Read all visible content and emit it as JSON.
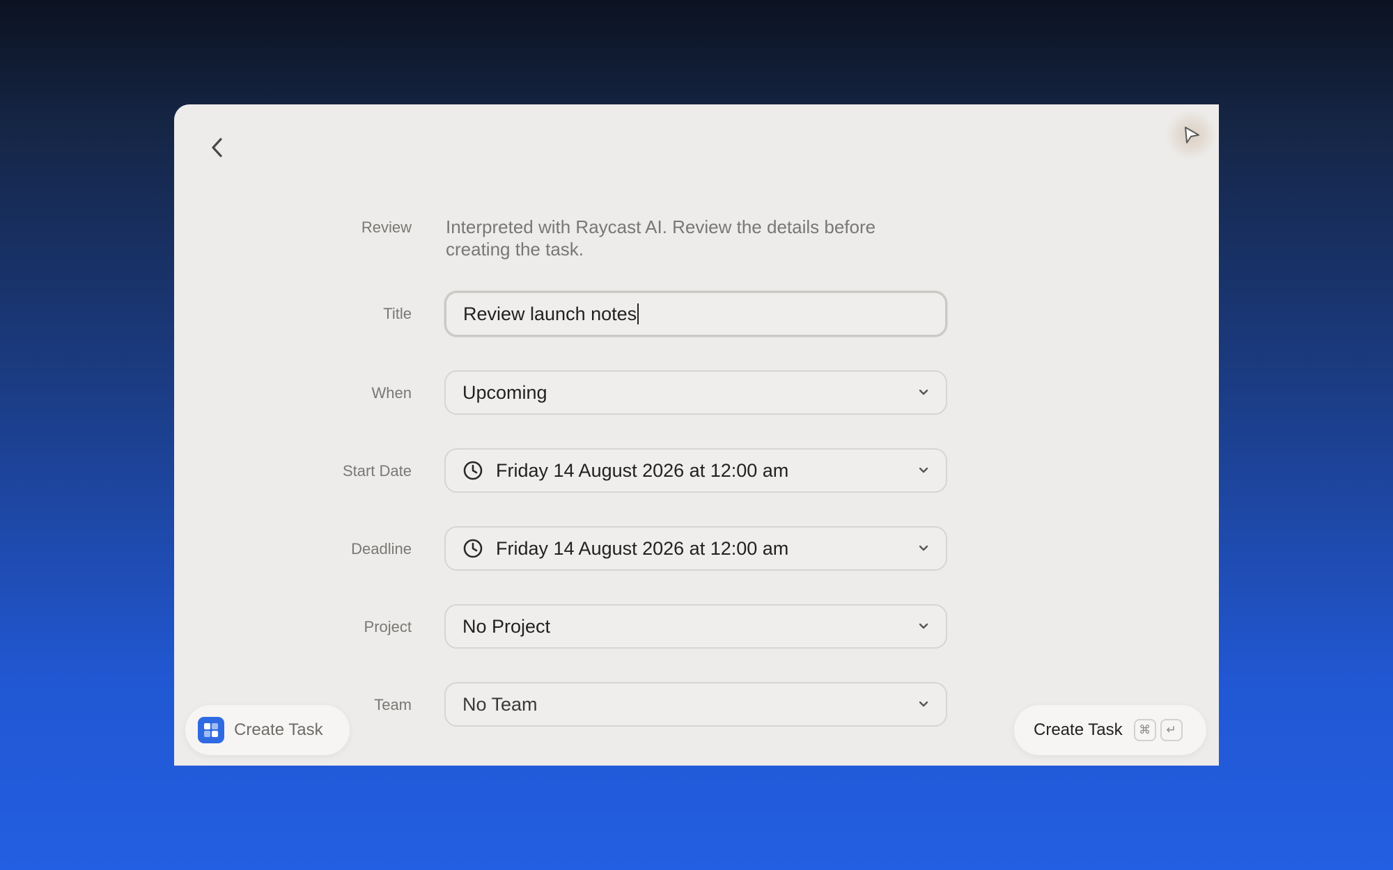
{
  "form": {
    "review": {
      "label": "Review",
      "text": "Interpreted with Raycast AI. Review the details before creating the task."
    },
    "title": {
      "label": "Title",
      "value": "Review launch notes"
    },
    "when": {
      "label": "When",
      "value": "Upcoming"
    },
    "start_date": {
      "label": "Start Date",
      "value": "Friday 14 August 2026 at 12:00 am"
    },
    "deadline": {
      "label": "Deadline",
      "value": "Friday 14 August 2026 at 12:00 am"
    },
    "project": {
      "label": "Project",
      "value": "No Project"
    },
    "team": {
      "label": "Team",
      "value": "No Team"
    }
  },
  "footer": {
    "left_label": "Create Task",
    "right_label": "Create Task",
    "shortcut_keys": [
      "⌘",
      "↵"
    ]
  },
  "icons": {
    "back": "chevron-left-icon",
    "corner": "cursor-arrow-icon",
    "clock": "clock-icon",
    "dropdown": "chevron-down-icon",
    "app": "app-logo-icon"
  },
  "colors": {
    "accent": "#2f6ae3",
    "window_bg": "#edecea"
  }
}
